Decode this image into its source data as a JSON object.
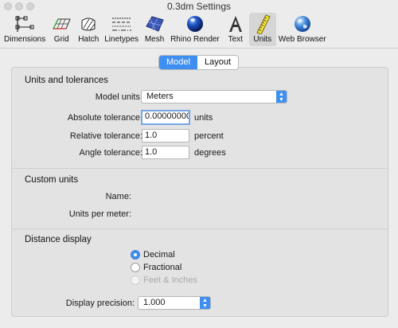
{
  "window": {
    "title": "0.3dm Settings"
  },
  "toolbar": {
    "items": [
      {
        "label": "Dimensions",
        "icon": "dimensions-icon"
      },
      {
        "label": "Grid",
        "icon": "grid-icon"
      },
      {
        "label": "Hatch",
        "icon": "hatch-icon"
      },
      {
        "label": "Linetypes",
        "icon": "linetypes-icon"
      },
      {
        "label": "Mesh",
        "icon": "mesh-icon"
      },
      {
        "label": "Rhino Render",
        "icon": "rhino-render-icon"
      },
      {
        "label": "Text",
        "icon": "text-icon"
      },
      {
        "label": "Units",
        "icon": "units-ruler-icon",
        "active": true
      },
      {
        "label": "Web Browser",
        "icon": "web-browser-globe-icon"
      }
    ]
  },
  "tabs": {
    "model": "Model",
    "layout": "Layout",
    "selected": "Model"
  },
  "units_tolerances": {
    "title": "Units and tolerances",
    "model_units_label": "Model units:",
    "model_units_value": "Meters",
    "abs_tol_label": "Absolute tolerance:",
    "abs_tol_value": "0.000000000",
    "abs_tol_unit": "units",
    "rel_tol_label": "Relative tolerance:",
    "rel_tol_value": "1.0",
    "rel_tol_unit": "percent",
    "angle_tol_label": "Angle tolerance:",
    "angle_tol_value": "1.0",
    "angle_tol_unit": "degrees"
  },
  "custom_units": {
    "title": "Custom units",
    "name_label": "Name:",
    "per_meter_label": "Units per meter:"
  },
  "distance_display": {
    "title": "Distance display",
    "options": [
      {
        "label": "Decimal",
        "selected": true,
        "disabled": false
      },
      {
        "label": "Fractional",
        "selected": false,
        "disabled": false
      },
      {
        "label": "Feet & Inches",
        "selected": false,
        "disabled": true
      }
    ],
    "precision_label": "Display precision:",
    "precision_value": "1.000"
  },
  "colors": {
    "accent": "#3f8ff3"
  }
}
